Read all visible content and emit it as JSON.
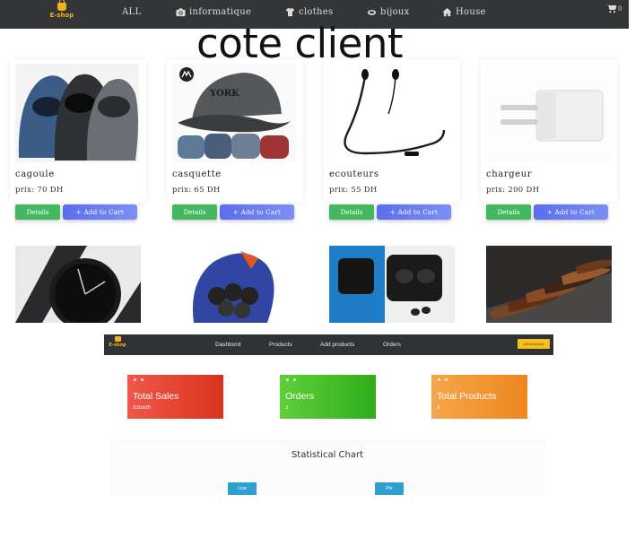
{
  "shop": {
    "logo": "E-shop",
    "nav": [
      {
        "label": "ALL",
        "icon": "none"
      },
      {
        "label": "informatique",
        "icon": "camera-icon"
      },
      {
        "label": "clothes",
        "icon": "tshirt-icon"
      },
      {
        "label": "bijoux",
        "icon": "ring-icon"
      },
      {
        "label": "House",
        "icon": "home-icon"
      }
    ],
    "cart_count": "0",
    "caption": "cote client",
    "details_label": "Details",
    "add_to_cart_label": "+ Add to Cart",
    "products": [
      {
        "name": "cagoule",
        "price": "prix: 70 DH"
      },
      {
        "name": "casquette",
        "price": "prix: 65 DH"
      },
      {
        "name": "ecouteurs",
        "price": "prix: 55 DH"
      },
      {
        "name": "chargeur",
        "price": "prix: 200 DH"
      }
    ],
    "second_row_images": [
      "watch",
      "motorcycle-glove",
      "wireless-earbuds",
      "leather-shoes"
    ]
  },
  "admin": {
    "logo": "E-shop",
    "links": [
      "Dashbord",
      "Products",
      "Add products",
      "Orders"
    ],
    "action_button": "Administrator",
    "stats": [
      {
        "label": "Total Sales",
        "value": "3355dh",
        "color_from": "#f0584a",
        "color_to": "#d9331b"
      },
      {
        "label": "Orders",
        "value": "3",
        "color_from": "#5fcf3a",
        "color_to": "#2fae1a"
      },
      {
        "label": "Total Products",
        "value": "8",
        "color_from": "#f5a64a",
        "color_to": "#ee861d"
      }
    ],
    "chart_title": "Statistical Chart",
    "chart_buttons": [
      "Line",
      "Pie"
    ]
  }
}
